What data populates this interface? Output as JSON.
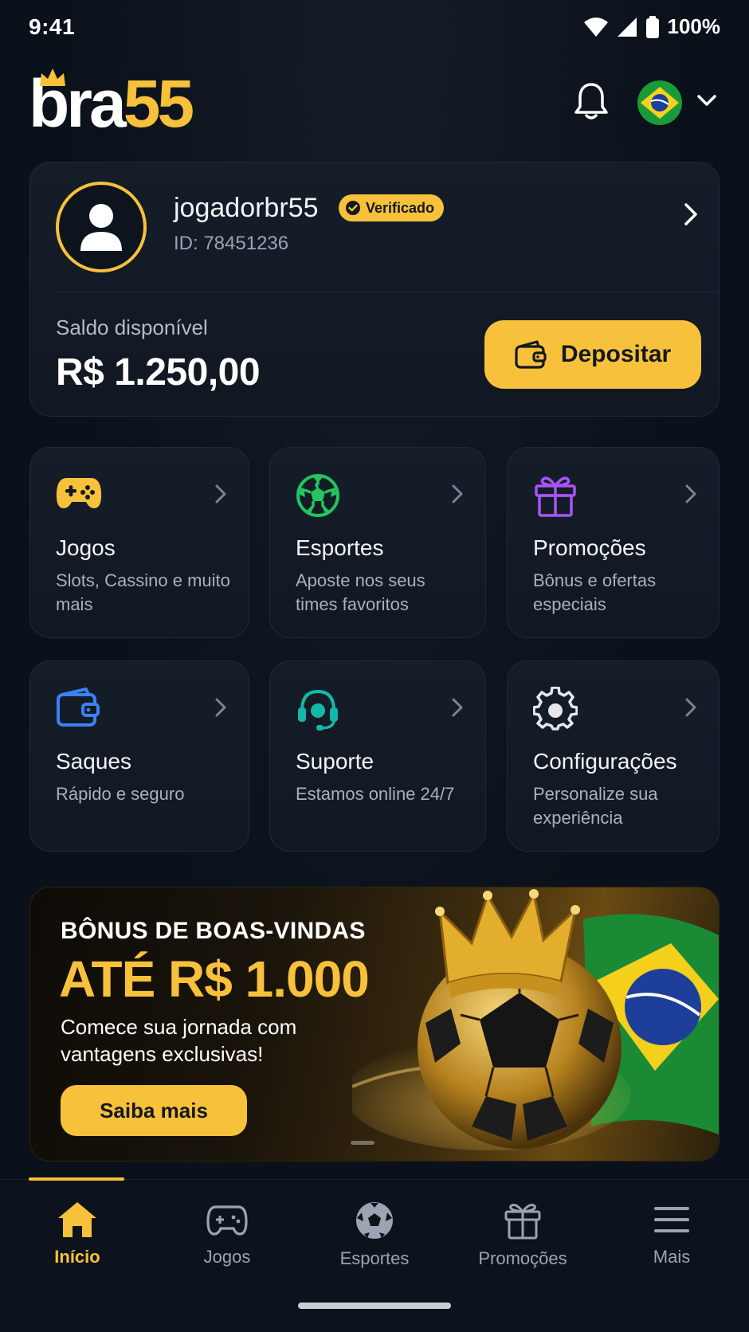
{
  "status_bar": {
    "time": "9:41",
    "battery": "100%"
  },
  "header": {
    "logo_primary": "bra",
    "logo_accent": "55",
    "icons": {
      "notifications": "bell-icon",
      "language": "brazil-flag",
      "dropdown": "chevron-down-icon"
    }
  },
  "profile": {
    "username": "jogadorbr55",
    "badge": "Verificado",
    "user_id": "ID: 78451236",
    "balance_label": "Saldo disponível",
    "balance_value": "R$ 1.250,00",
    "deposit_label": "Depositar"
  },
  "tiles": [
    {
      "title": "Jogos",
      "desc": "Slots, Cassino e muito mais",
      "icon": "gamepad-icon",
      "color": "#f7c13b"
    },
    {
      "title": "Esportes",
      "desc": "Aposte nos seus times favoritos",
      "icon": "soccer-ball-icon",
      "color": "#22c55e"
    },
    {
      "title": "Promoções",
      "desc": "Bônus e ofertas especiais",
      "icon": "gift-icon",
      "color": "#a855f7"
    },
    {
      "title": "Saques",
      "desc": "Rápido e seguro",
      "icon": "wallet-icon",
      "color": "#3b82f6"
    },
    {
      "title": "Suporte",
      "desc": "Estamos online 24/7",
      "icon": "headset-icon",
      "color": "#14b8a6"
    },
    {
      "title": "Configurações",
      "desc": "Personalize sua experiência",
      "icon": "gear-icon",
      "color": "#e5e7eb"
    }
  ],
  "banner": {
    "kicker": "BÔNUS DE BOAS-VINDAS",
    "amount": "ATÉ R$ 1.000",
    "subtitle": "Comece sua jornada com vantagens exclusivas!",
    "cta": "Saiba mais"
  },
  "bottom_nav": [
    {
      "label": "Início",
      "icon": "home-icon",
      "active": true
    },
    {
      "label": "Jogos",
      "icon": "gamepad-icon",
      "active": false
    },
    {
      "label": "Esportes",
      "icon": "soccer-ball-icon",
      "active": false
    },
    {
      "label": "Promoções",
      "icon": "gift-icon",
      "active": false
    },
    {
      "label": "Mais",
      "icon": "menu-icon",
      "active": false
    }
  ],
  "colors": {
    "accent": "#f7c13b",
    "background": "#0b111a",
    "card": "#131b26"
  }
}
